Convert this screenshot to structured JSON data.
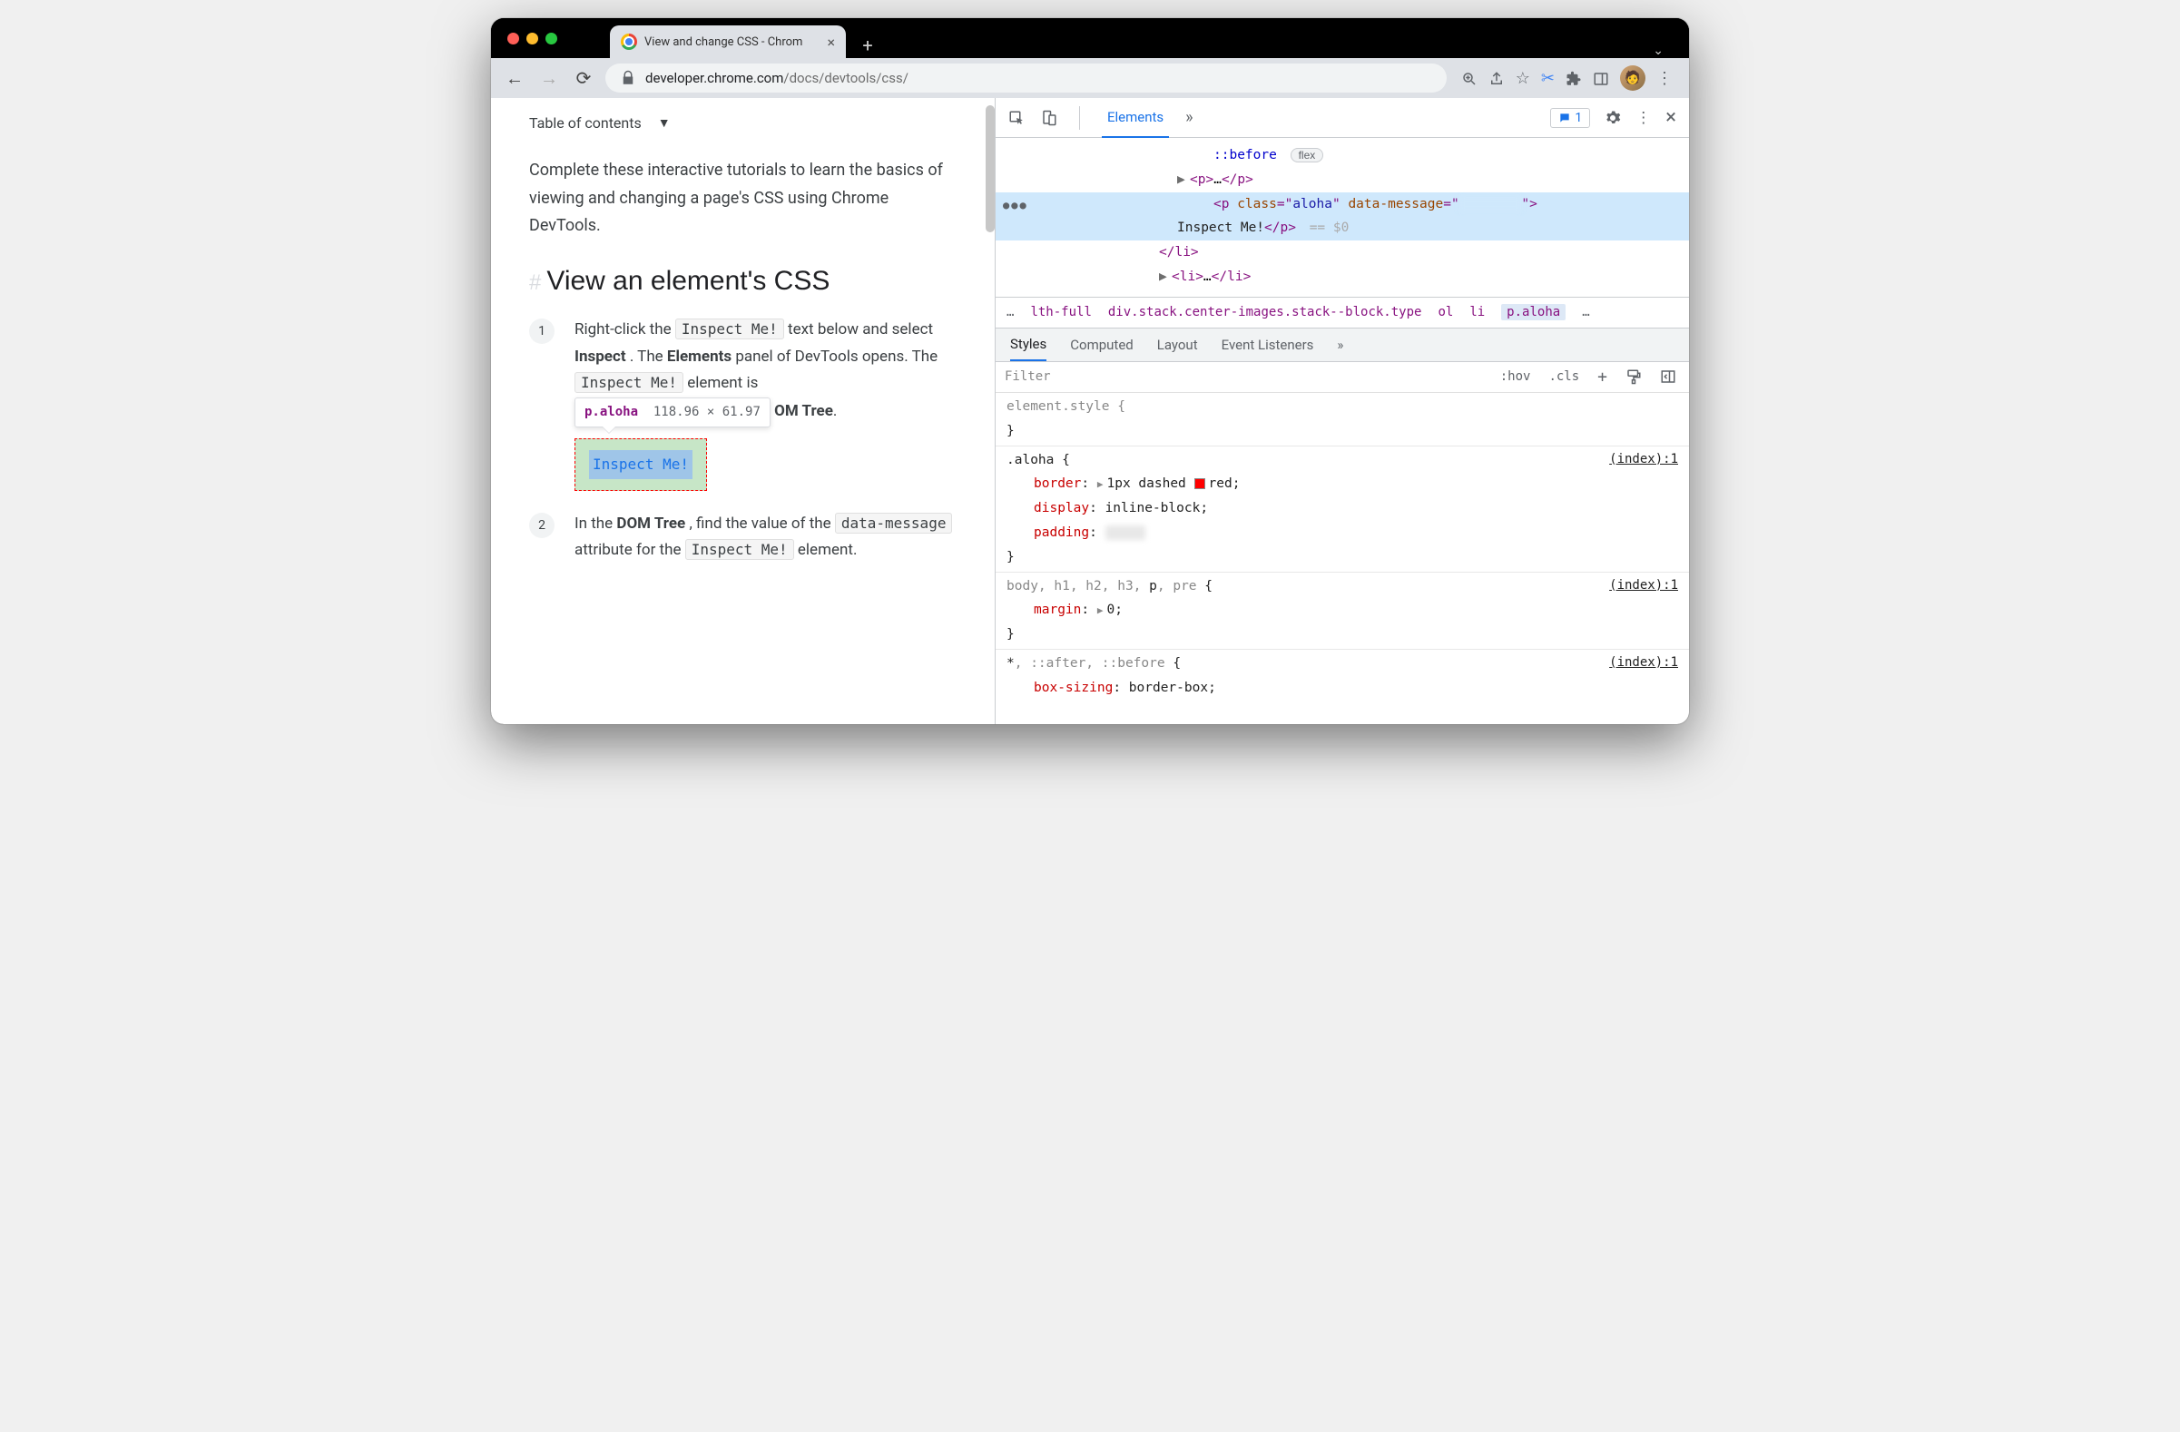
{
  "window": {
    "tab_title": "View and change CSS - Chrom",
    "url_domain": "developer.chrome.com",
    "url_path": "/docs/devtools/css/"
  },
  "page": {
    "toc_label": "Table of contents",
    "intro": "Complete these interactive tutorials to learn the basics of viewing and changing a page's CSS using Chrome DevTools.",
    "heading": "View an element's CSS",
    "step1_a": "Right-click the ",
    "step1_code1": "Inspect Me!",
    "step1_b": " text below and select ",
    "step1_bold1": "Inspect",
    "step1_c": ". The ",
    "step1_bold2": "Elements",
    "step1_d": " panel of DevTools opens. The ",
    "step1_code2": "Inspect Me!",
    "step1_e": " element is ",
    "step1_partial": "OM Tree",
    "step1_f": ".",
    "tooltip_selector": "p.aloha",
    "tooltip_dims": "118.96 × 61.97",
    "inspect_label": "Inspect Me!",
    "step2_a": "In the ",
    "step2_bold1": "DOM Tree",
    "step2_b": ", find the value of the ",
    "step2_code1": "data-message",
    "step2_c": " attribute for the ",
    "step2_code2": "Inspect Me!",
    "step2_d": " element."
  },
  "devtools": {
    "main_tabs": {
      "elements": "Elements"
    },
    "issue_count": "1",
    "tree": {
      "before": "::before",
      "flex_badge": "flex",
      "p_open": "<p>",
      "ellipsis": "…",
      "p_close": "</p>",
      "sel_open1": "<p ",
      "sel_attr1": "class",
      "sel_val1": "aloha",
      "sel_attr2": "data-message",
      "sel_close": ">",
      "sel_text": "Inspect Me!",
      "sel_end": "</p>",
      "eq_dollar": "== $0",
      "li_close": "</li>",
      "li_open": "<li>",
      "li_close2": "</li>"
    },
    "breadcrumb": {
      "i0": "…",
      "i1": "lth-full",
      "i2": "div.stack.center-images.stack--block.type",
      "i3": "ol",
      "i4": "li",
      "i5": "p.aloha",
      "i6": "…"
    },
    "subtabs": {
      "styles": "Styles",
      "computed": "Computed",
      "layout": "Layout",
      "listeners": "Event Listeners"
    },
    "filter": {
      "placeholder": "Filter",
      "hov": ":hov",
      "cls": ".cls"
    },
    "rules": {
      "el_style": "element.style {",
      "brace_close": "}",
      "src": "(index):1",
      "aloha_sel": ".aloha",
      "p_border_n": "border",
      "p_border_v": "1px dashed ",
      "p_border_color": "red",
      "p_display_n": "display",
      "p_display_v": "inline-block",
      "p_padding_n": "padding",
      "body_sel_gray": "body, h1, h2, h3, ",
      "body_sel_match": "p",
      "body_sel_gray2": ", pre",
      "p_margin_n": "margin",
      "p_margin_v": "0",
      "star_sel_match": "*",
      "star_sel_gray": ", ::after, ::before",
      "p_box_n": "box-sizing",
      "p_box_v": "border-box"
    }
  }
}
